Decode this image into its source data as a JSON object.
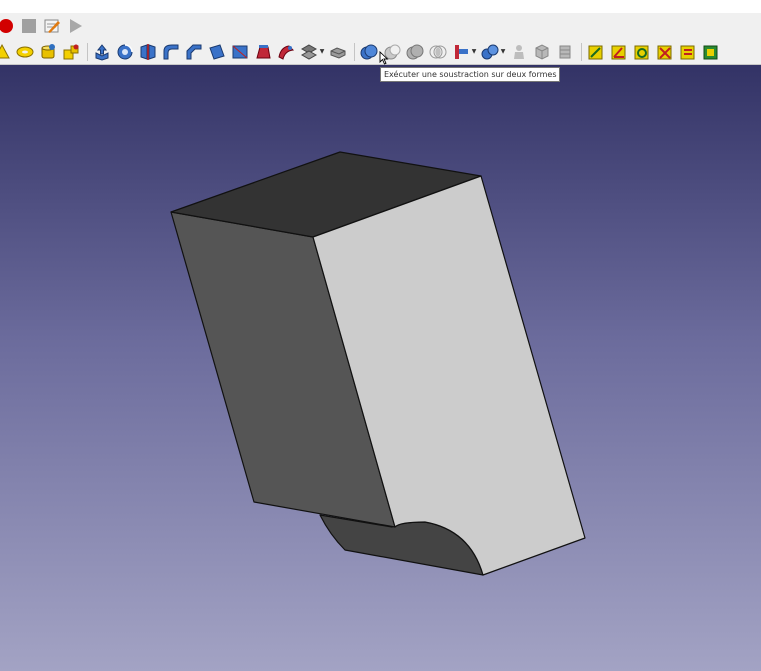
{
  "macro_toolbar": {
    "icons": [
      "record-icon",
      "stop-icon",
      "edit-macro-icon",
      "run-macro-icon"
    ]
  },
  "part_toolbar": {
    "primitives": [
      "cone-icon",
      "torus-icon",
      "tube-icon",
      "create-primitives-icon",
      "shape-builder-icon"
    ],
    "modeling": [
      "extrude-icon",
      "revolve-icon",
      "mirror-icon",
      "fillet-icon",
      "chamfer-icon",
      "make-face-icon",
      "ruled-surface-icon",
      "loft-icon",
      "sweep-icon",
      "section-icon",
      "cross-sections-icon",
      "offset-icon",
      "thickness-icon",
      "projection-icon"
    ],
    "boolean": [
      "boolean-icon",
      "cut-icon",
      "fuse-icon",
      "common-icon",
      "join-icon",
      "split-icon",
      "compound-tools-icon",
      "check-geometry-icon",
      "defeaturing-icon",
      "measure-linear-icon",
      "measure-angular-icon",
      "measure-refresh-icon",
      "measure-clear-icon",
      "measure-toggle-icon"
    ]
  },
  "tooltip": {
    "text": "Exécuter une soustraction sur deux formes"
  },
  "viewport": {
    "background_top": "#333366",
    "background_bottom": "#a3a3c4",
    "object_faces": {
      "top": "#333333",
      "left": "#555555",
      "right": "#cccccc",
      "bottom": "#444444"
    }
  }
}
